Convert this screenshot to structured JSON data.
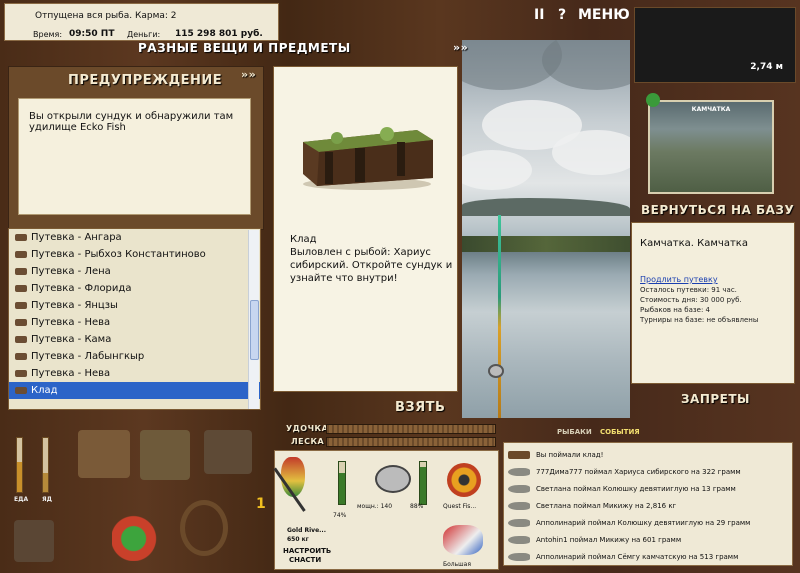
{
  "status": {
    "message": "Отпущена вся рыба. Карма: 2",
    "time_label": "Время:",
    "time_value": "09:50 ПТ",
    "money_label": "Деньги:",
    "money_value": "115 298 801 руб."
  },
  "menu": {
    "pause": "II",
    "help": "?",
    "menu_label": "МЕНЮ"
  },
  "items_panel": {
    "title": "РАЗНЫЕ ВЕЩИ И ПРЕДМЕТЫ",
    "arrows": "»»"
  },
  "warning": {
    "title": "ПРЕДУПРЕЖДЕНИЕ",
    "arrows": "»»",
    "text": "Вы открыли сундук и обнаружили там удилище Ecko Fish"
  },
  "list": {
    "items": [
      "Путевка - Ангара",
      "Путевка - Рыбхоз Константиново",
      "Путевка - Лена",
      "Путевка - Флорида",
      "Путевка - Янцзы",
      "Путевка - Нева",
      "Путевка - Кама",
      "Путевка - Лабынгкыр",
      "Путевка - Нева",
      "Клад"
    ],
    "selected_index": 9
  },
  "detail": {
    "name": "Клад",
    "description": "Выловлен с рыбой: Хариус сибирский. Откройте сундук и узнайте что внутри!",
    "take_label": "ВЗЯТЬ"
  },
  "depth": {
    "value": "2,74 м"
  },
  "map": {
    "caption": "КАМЧАТКА"
  },
  "base": {
    "return_label": "ВЕРНУТЬСЯ НА БАЗУ",
    "place": "Камчатка. Камчатка",
    "extend_link": "Продлить путевку",
    "remaining": "Осталось путевки: 91 час.",
    "cost": "Стоимость дня: 30 000 руб.",
    "fishers": "Рыбаков на базе: 4",
    "tournaments": "Турниры на базе: не объявлены",
    "bans_label": "ЗАПРЕТЫ"
  },
  "tackle": {
    "rod_label": "УДОЧКА",
    "line_label": "ЛЕСКА"
  },
  "tabs": {
    "fishers": "РЫБАКИ",
    "events": "СОБЫТИЯ"
  },
  "events": {
    "items": [
      "Вы поймали клад!",
      "777Дима777 поймал Хариуса сибирского на 322 грамм",
      "Светлана поймал Колюшку девятииглую на 13 грамм",
      "Светлана поймал Микижу на 2,816 кг",
      "Апполинарий поймал Колюшку девятииглую на 29 грамм",
      "Antohin1 поймал Микижу на 601 грамм",
      "Апполинарий поймал Сёмгу камчатскую на 513 грамм"
    ]
  },
  "gear": {
    "rod_name": "Gold Rive...",
    "rod_weight": "650 кг",
    "rod_pct": "74%",
    "reel_label": "мощн.: 140",
    "reel_pct": "88%",
    "line_name": "Quest Fis...",
    "lure_label": "Большая",
    "setup_label_1": "НАСТРОИТЬ",
    "setup_label_2": "СНАСТИ"
  },
  "food": {
    "food_label": "ЕДА",
    "poison_label": "ЯД",
    "food_level": 0.55,
    "poison_level": 0.35
  },
  "counter": {
    "value": "1"
  },
  "colors": {
    "accent": "#2c64c8",
    "panel": "#f3eedc",
    "wood": "#4a2c17"
  }
}
